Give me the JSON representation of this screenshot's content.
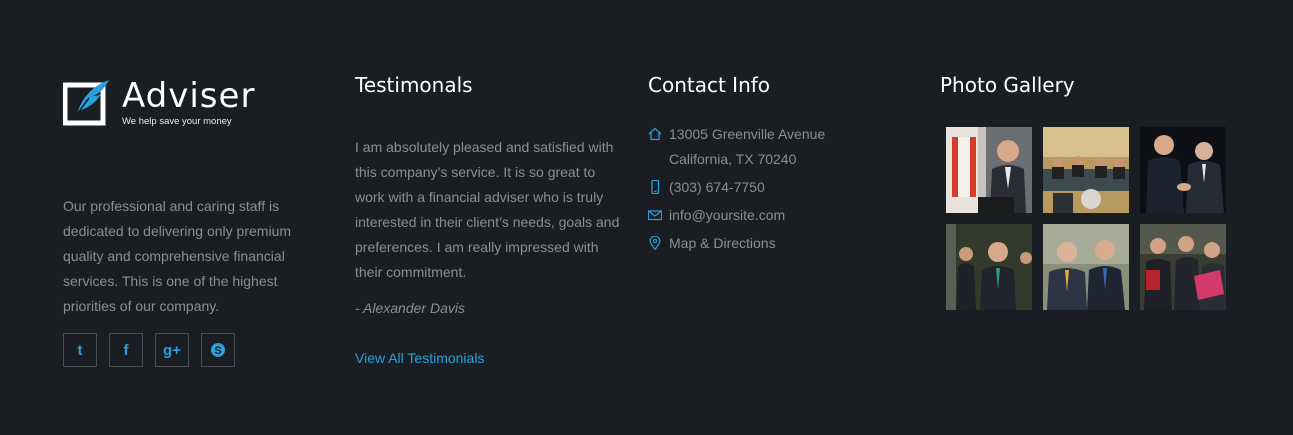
{
  "brand": {
    "name": "Adviser",
    "tagline": "We help save your money"
  },
  "about": {
    "text": "Our professional and caring staff is dedicated to delivering only premium quality and comprehensive financial services. This is one of the highest priorities of our company."
  },
  "social": [
    {
      "name": "tumblr",
      "glyph": "t"
    },
    {
      "name": "facebook",
      "glyph": "f"
    },
    {
      "name": "google-plus",
      "glyph": "g+"
    },
    {
      "name": "skype",
      "glyph": "S"
    }
  ],
  "testimonials": {
    "heading": "Testimonals",
    "quote": "I am absolutely pleased and satisfied with this company’s service. It is so great to work with a financial adviser who is truly interested in their client’s needs, goals and preferences. I am really impressed with their commitment.",
    "author": "- Alexander Davis",
    "link": "View All Testimonials"
  },
  "contact": {
    "heading": "Contact Info",
    "address_line1": "13005 Greenville Avenue",
    "address_line2": "California, TX 70240",
    "phone": "(303) 674-7750",
    "email": "info@yoursite.com",
    "map": "Map & Directions"
  },
  "gallery": {
    "heading": "Photo Gallery",
    "photos": [
      "photo-1",
      "photo-2",
      "photo-3",
      "photo-4",
      "photo-5",
      "photo-6"
    ]
  },
  "colors": {
    "background": "#1a1e22",
    "accent": "#2aa0dc",
    "text": "#8a8f94",
    "heading": "#ffffff"
  }
}
